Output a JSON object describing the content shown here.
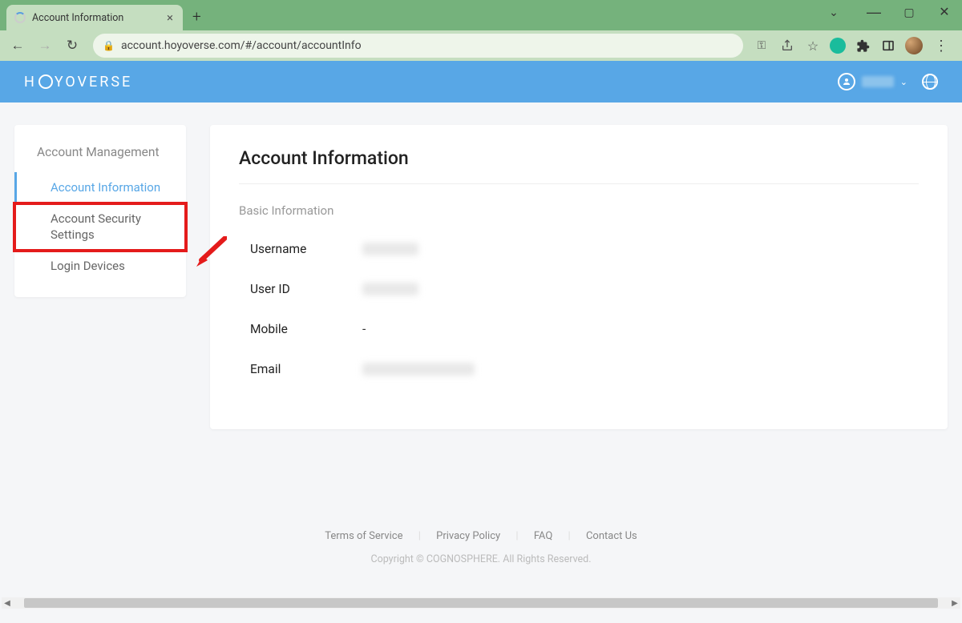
{
  "browser": {
    "tab_title": "Account Information",
    "url": "account.hoyoverse.com/#/account/accountInfo"
  },
  "header": {
    "brand": "HOYOVERSE"
  },
  "sidebar": {
    "title": "Account Management",
    "items": [
      {
        "label": "Account Information",
        "active": true
      },
      {
        "label": "Account Security Settings",
        "active": false,
        "highlight": true
      },
      {
        "label": "Login Devices",
        "active": false
      }
    ]
  },
  "main": {
    "title": "Account Information",
    "section": "Basic Information",
    "rows": {
      "username_label": "Username",
      "userid_label": "User ID",
      "mobile_label": "Mobile",
      "mobile_value": "-",
      "email_label": "Email"
    }
  },
  "footer": {
    "links": {
      "tos": "Terms of Service",
      "privacy": "Privacy Policy",
      "faq": "FAQ",
      "contact": "Contact Us"
    },
    "copyright": "Copyright © COGNOSPHERE. All Rights Reserved."
  }
}
